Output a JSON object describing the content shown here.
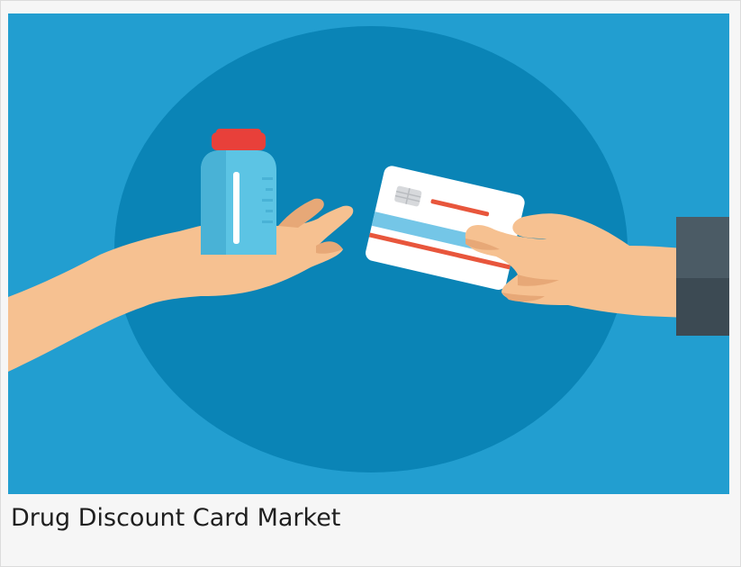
{
  "card": {
    "title": "Drug Discount Card Market"
  },
  "illustration": {
    "subject": "pill-bottle-and-credit-card-exchange",
    "colors": {
      "background": "#229ed0",
      "circle": "#0a84b6",
      "skin": "#f6c191",
      "skin_shadow": "#e7a877",
      "bottle": "#5cc4e4",
      "bottle_dark": "#49b2d6",
      "cap": "#e8403a",
      "card": "#ffffff",
      "card_stripe": "#e8563c",
      "card_band": "#74c6e7",
      "sleeve": "#4b5b65"
    }
  }
}
